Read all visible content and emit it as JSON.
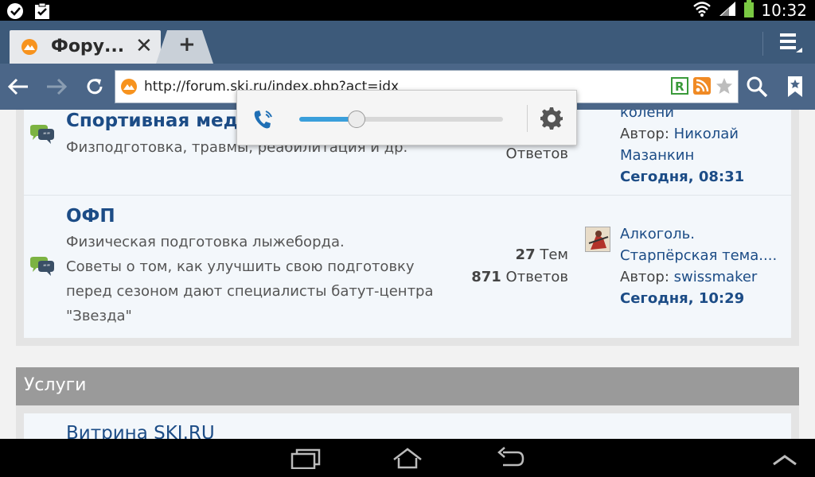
{
  "status_bar": {
    "time": "10:32",
    "left_icons": [
      "check-circle-icon",
      "clipboard-icon"
    ],
    "right_icons": [
      "wifi-icon",
      "signal-icon",
      "battery-icon"
    ]
  },
  "browser": {
    "tab": {
      "title": "Фору...",
      "close_glyph": "✕"
    },
    "new_tab_glyph": "+",
    "url": "http://forum.ski.ru/index.php?act=idx",
    "accent": "#3d5a7a"
  },
  "volume_popup": {
    "level_fraction": 0.28,
    "accent": "#3a9fdb"
  },
  "forums": [
    {
      "title": "Спортивная меди",
      "description": "Физподготовка, травмы, реабилитация и др.",
      "topics_value": "",
      "topics_label": "",
      "replies_value": "",
      "replies_label": "Ответов",
      "last_post": {
        "title_lines": [
          "колени"
        ],
        "author_label": "Автор:",
        "author": "Николай",
        "author_cont": "Мазанкин",
        "date": "Сегодня, 08:31"
      }
    },
    {
      "title": "ОФП",
      "description_lines": [
        "Физическая подготовка лыжеборда.",
        "Советы о том, как улучшить свою подготовку",
        "перед сезоном дают специалисты батут-центра",
        "\"Звезда\""
      ],
      "topics_value": "27",
      "topics_label": "Тем",
      "replies_value": "871",
      "replies_label": "Ответов",
      "last_post": {
        "title_lines": [
          "Алкоголь.",
          "Старпёрская тема...."
        ],
        "author_label": "Автор:",
        "author": "swissmaker",
        "date": "Сегодня, 10:29"
      }
    }
  ],
  "section": {
    "title": "Услуги",
    "first_item": "Витрина SKI.RU"
  }
}
